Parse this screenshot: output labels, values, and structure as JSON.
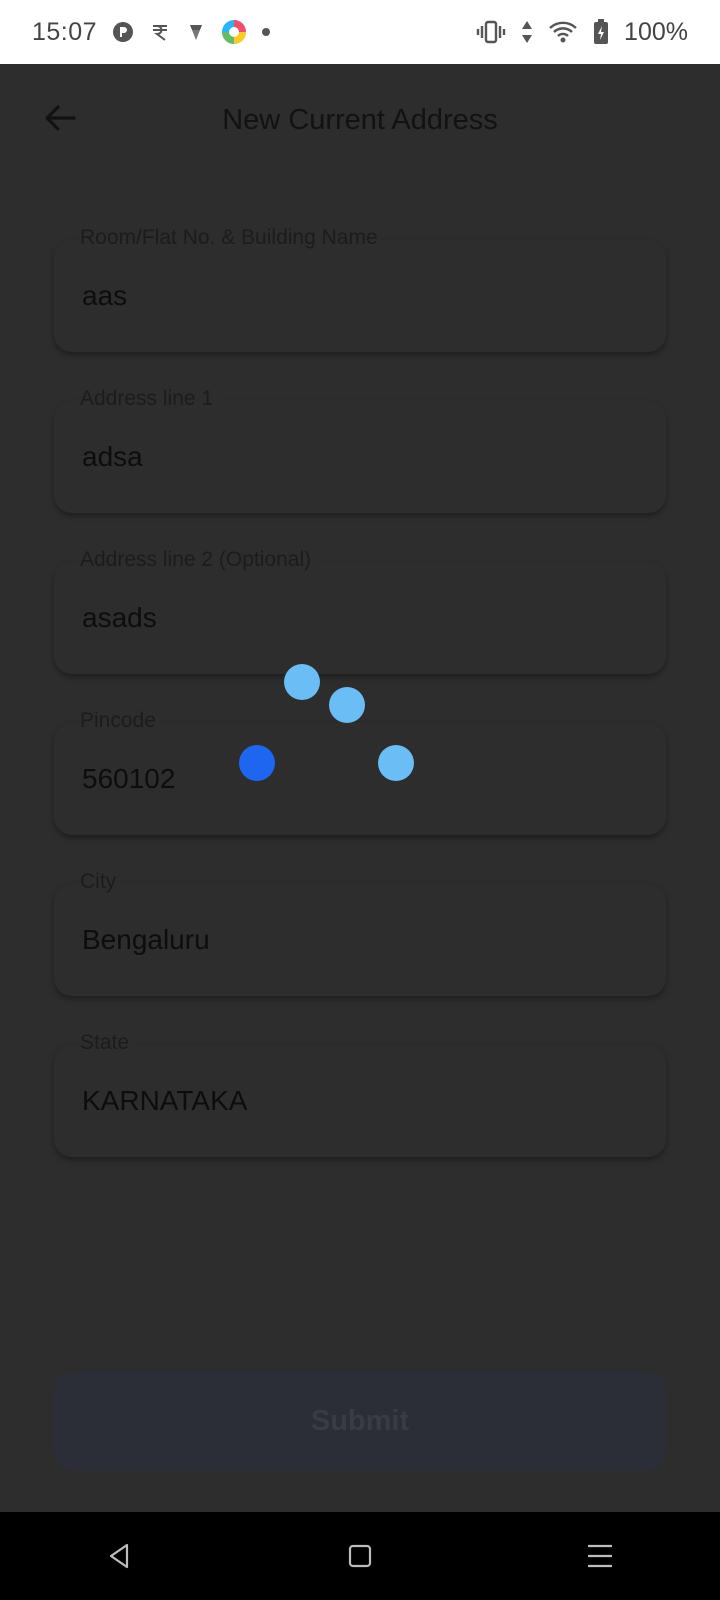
{
  "status_bar": {
    "time": "15:07",
    "battery_text": "100%",
    "icons_left": [
      "app-notification-icon",
      "rupee-app-icon",
      "diamond-app-icon",
      "color-wheel-app-icon",
      "dot-icon"
    ],
    "icons_right": [
      "vibrate-icon",
      "data-arrows-icon",
      "wifi-icon",
      "battery-charging-icon"
    ]
  },
  "header": {
    "title": "New Current Address",
    "back_icon": "arrow-left-icon"
  },
  "form": {
    "fields": [
      {
        "label": "Room/Flat No. & Building Name",
        "value": "aas"
      },
      {
        "label": "Address line 1",
        "value": "adsa"
      },
      {
        "label": "Address line 2 (Optional)",
        "value": "asads"
      },
      {
        "label": "Pincode",
        "value": "560102"
      },
      {
        "label": "City",
        "value": "Bengaluru"
      },
      {
        "label": "State",
        "value": "KARNATAKA"
      }
    ],
    "submit_label": "Submit"
  },
  "colors": {
    "overlay_dim": "#2d2d2d",
    "loader_light": "#6bbdf5",
    "loader_dark": "#1e66f0"
  },
  "nav_bar": {
    "icons": [
      "back-triangle-icon",
      "home-square-icon",
      "menu-lines-icon"
    ]
  }
}
